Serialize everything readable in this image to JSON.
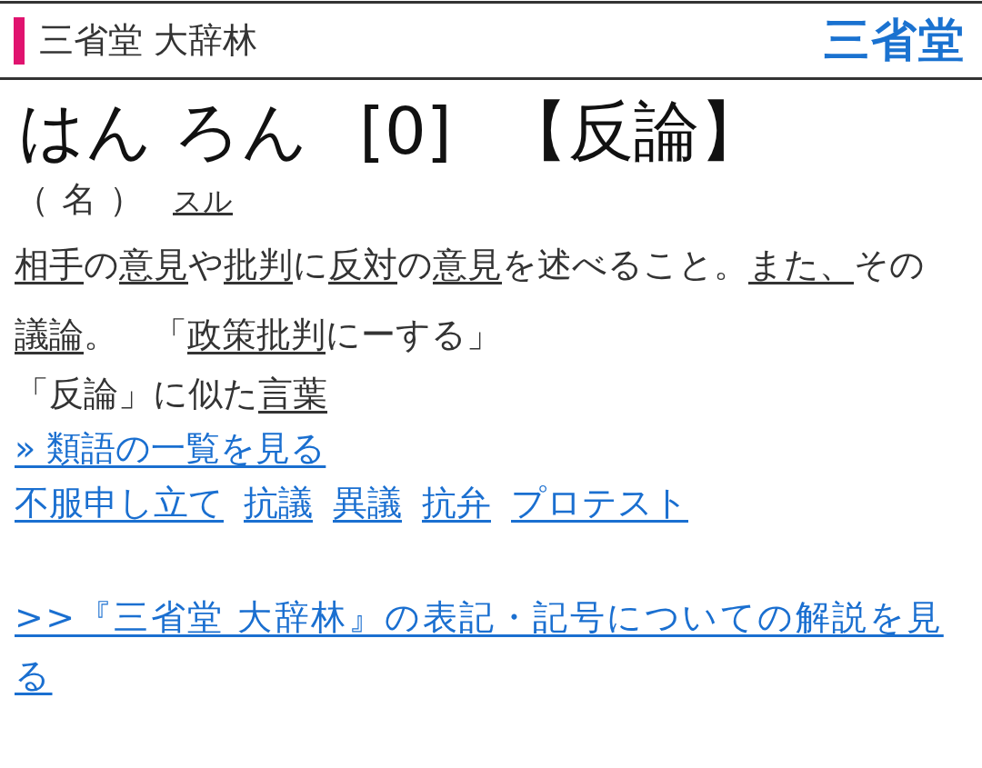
{
  "header": {
    "title": "三省堂 大辞林",
    "logo": "三省堂"
  },
  "entry": {
    "reading": "はん ろん",
    "accent": "[0]",
    "headword": "【反論】",
    "pos": "（名）",
    "pos_link": "スル",
    "definition": [
      {
        "text": "相手",
        "kind": "link"
      },
      {
        "text": "の",
        "kind": "text"
      },
      {
        "text": "意見",
        "kind": "link"
      },
      {
        "text": "や",
        "kind": "text"
      },
      {
        "text": "批判",
        "kind": "link"
      },
      {
        "text": "に",
        "kind": "text"
      },
      {
        "text": "反対",
        "kind": "link"
      },
      {
        "text": "の",
        "kind": "text"
      },
      {
        "text": "意見",
        "kind": "link"
      },
      {
        "text": "を述べること。",
        "kind": "text"
      },
      {
        "text": "また、",
        "kind": "link"
      },
      {
        "text": "その",
        "kind": "text"
      },
      {
        "text": "議論",
        "kind": "link"
      },
      {
        "text": "。　「",
        "kind": "text"
      },
      {
        "text": "政策批判",
        "kind": "link"
      },
      {
        "text": "にーする」",
        "kind": "text"
      }
    ]
  },
  "similar": {
    "heading": [
      {
        "text": "「反論」に似た",
        "kind": "text"
      },
      {
        "text": "言葉",
        "kind": "link"
      }
    ],
    "more_link": "» 類語の一覧を見る",
    "words": [
      "不服申し立て",
      "抗議",
      "異議",
      "抗弁",
      "プロテスト"
    ]
  },
  "notation_link": ">>『三省堂 大辞林』の表記・記号についての解説を見る"
}
